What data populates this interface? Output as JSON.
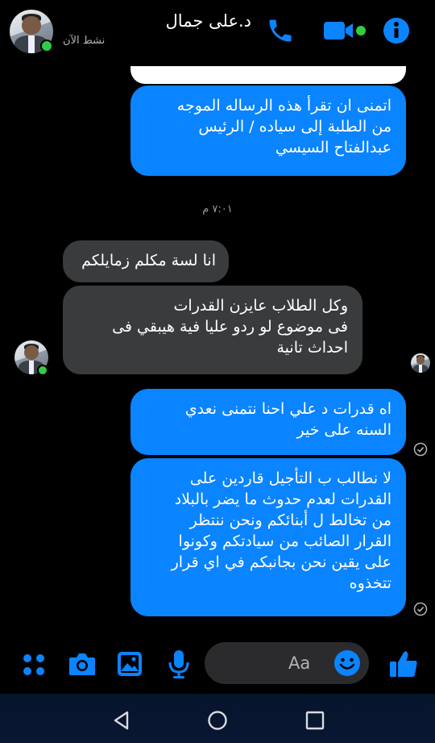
{
  "header": {
    "contact_name": "د.على جمال",
    "status": "نشط الآن",
    "icons": [
      "phone-icon",
      "video-call-icon",
      "info-icon"
    ]
  },
  "messages": [
    {
      "id": "m1",
      "direction": "outgoing",
      "text": "اتمنى ان تقرأ هذه الرساله الموجه\nمن الطلبة إلى سياده / الرئيس\nعبدالفتاح السيسي"
    },
    {
      "id": "m2",
      "direction": "incoming",
      "text": "انا لسة مكلم زمايلكم"
    },
    {
      "id": "m3",
      "direction": "incoming",
      "text": "وكل الطلاب عايزن القدرات\nفى موضوع لو ردو عليا فية هيبقي فى\nاحداث تانية"
    },
    {
      "id": "m4",
      "direction": "outgoing",
      "text": "اه قدرات د علي احنا نتمنى نعدي\nالسنه على خير"
    },
    {
      "id": "m5",
      "direction": "outgoing",
      "text": "لا نطالب ب التأجيل قاردين على\nالقدرات لعدم حدوث ما يضر بالبلاد\nمن تخالط ل أبنائكم ونحن ننتظر\nالقرار الصائب من سيادتكم وكونوا\nعلى يقين نحن بجانبكم في اي قرار\nتتخذوه"
    }
  ],
  "timestamp": "٧:٠١ م",
  "composer": {
    "placeholder": "Aa",
    "icons": [
      "apps-icon",
      "camera-icon",
      "gallery-icon",
      "microphone-icon",
      "emoji-icon",
      "like-icon"
    ]
  },
  "colors": {
    "outgoing_bubble": "#0a84ff",
    "incoming_bubble": "#3a3b3c",
    "accent": "#0a84ff",
    "online": "#31cc46",
    "background": "#000000"
  },
  "navbar": {
    "icons": [
      "back-icon",
      "home-icon",
      "recents-icon"
    ]
  }
}
